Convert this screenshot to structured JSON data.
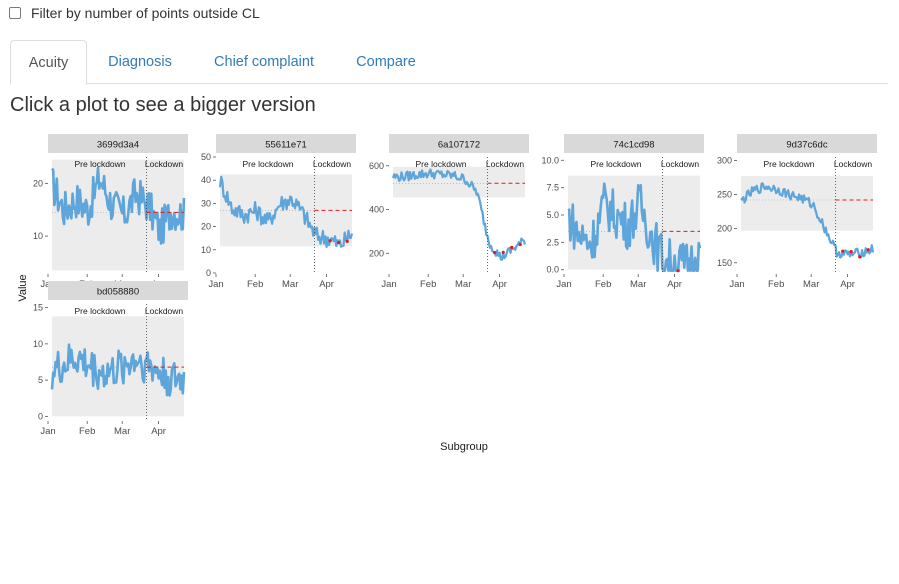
{
  "filter": {
    "label": "Filter by number of points outside CL",
    "checked": false
  },
  "tabs": [
    {
      "label": "Acuity",
      "active": true
    },
    {
      "label": "Diagnosis",
      "active": false
    },
    {
      "label": "Chief complaint",
      "active": false
    },
    {
      "label": "Compare",
      "active": false
    }
  ],
  "heading": "Click a plot to see a bigger version",
  "colors": {
    "series": "#5da5da",
    "limit": "#e41a1c",
    "band": "#ececec",
    "strip": "#d9d9d9"
  },
  "chart_data": {
    "type": "line",
    "x_axis_label": "Subgroup",
    "y_axis_label": "Value",
    "x_tick_labels": [
      "Jan",
      "Feb",
      "Mar",
      "Apr"
    ],
    "phase_labels": [
      "Pre lockdown",
      "Lockdown"
    ],
    "grid": false,
    "panels": [
      {
        "id": "3699d3a4",
        "yticks": [
          10,
          20
        ],
        "ylim": [
          3,
          25
        ],
        "pre_band": [
          3.5,
          24.5
        ],
        "pre_mean": 14.5,
        "post_mean": 14.5,
        "anchors": [
          20,
          15,
          17,
          15,
          21,
          16,
          14,
          18,
          16,
          11,
          15,
          14
        ],
        "noise": 3.0,
        "dense": true
      },
      {
        "id": "55611e71",
        "yticks": [
          0,
          10,
          20,
          30,
          40,
          50
        ],
        "ylim": [
          0,
          50
        ],
        "pre_band": [
          11.5,
          42.5
        ],
        "pre_mean": 27,
        "post_mean": 27,
        "anchors": [
          40,
          28,
          25,
          27,
          22,
          30,
          32,
          25,
          16,
          15,
          12,
          17
        ],
        "noise": 4.0,
        "dense": false
      },
      {
        "id": "6a107172",
        "yticks": [
          200,
          400,
          600
        ],
        "ylim": [
          110,
          640
        ],
        "pre_band": [
          455,
          595
        ],
        "pre_mean": 520,
        "post_mean": 520,
        "anchors": [
          550,
          550,
          560,
          565,
          560,
          555,
          540,
          480,
          250,
          180,
          220,
          260
        ],
        "noise": 22,
        "dense": false
      },
      {
        "id": "74c1cd98",
        "yticks": [
          0.0,
          2.5,
          5.0,
          7.5,
          10.0
        ],
        "ylim": [
          -0.3,
          10.3
        ],
        "pre_band": [
          0,
          8.6
        ],
        "pre_mean": 3.5,
        "post_mean": 3.5,
        "anchors": [
          5,
          3,
          2.5,
          6,
          5,
          4,
          6,
          3,
          1,
          0.5,
          0.5,
          1.5
        ],
        "noise": 1.8,
        "dense": true
      },
      {
        "id": "9d37c6dc",
        "yticks": [
          150,
          200,
          250,
          300
        ],
        "ylim": [
          135,
          305
        ],
        "pre_band": [
          197,
          277
        ],
        "pre_mean": 242,
        "post_mean": 242,
        "anchors": [
          240,
          255,
          262,
          258,
          250,
          245,
          235,
          200,
          165,
          162,
          165,
          170
        ],
        "noise": 7,
        "dense": false
      },
      {
        "id": "bd058880",
        "yticks": [
          0,
          5,
          10,
          15
        ],
        "ylim": [
          -0.5,
          15.5
        ],
        "pre_band": [
          0,
          13.8
        ],
        "pre_mean": 6.8,
        "post_mean": 6.8,
        "anchors": [
          6,
          7,
          8,
          7,
          6,
          6,
          7,
          8,
          7,
          6,
          5,
          5
        ],
        "noise": 2.2,
        "dense": true
      }
    ]
  }
}
